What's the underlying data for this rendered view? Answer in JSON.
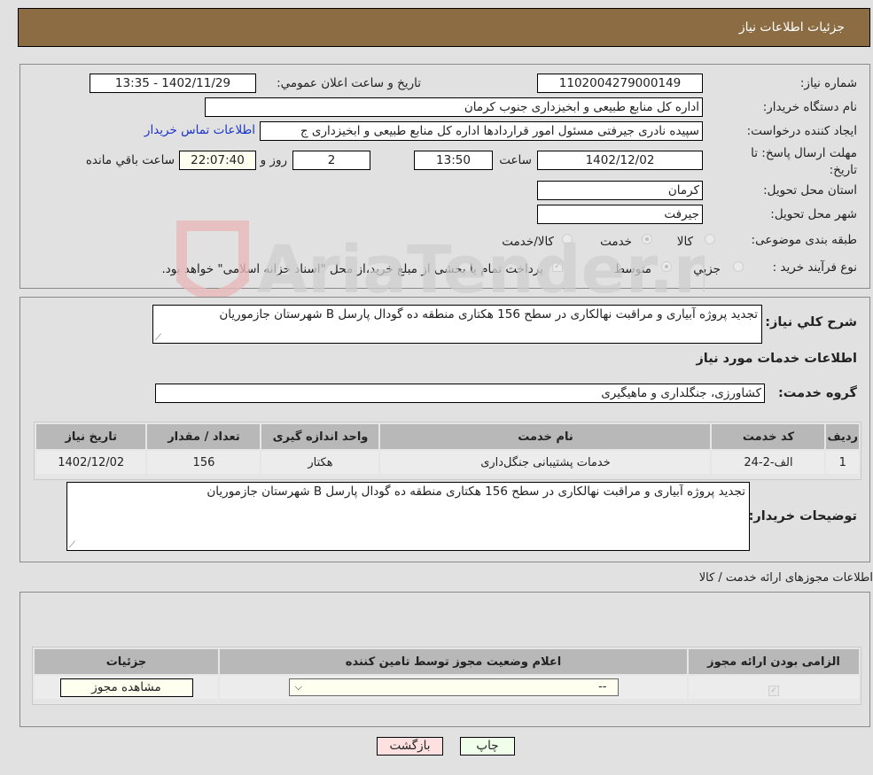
{
  "header": {
    "title": "جزئیات اطلاعات نیاز"
  },
  "details": {
    "need_number_label": "شماره نیاز:",
    "need_number": "1102004279000149",
    "announce_label": "تاریخ و ساعت اعلان عمومي:",
    "announce_value": "1402/11/29 - 13:35",
    "buyer_org_label": "نام دستگاه خريدار:",
    "buyer_org": "اداره کل منابع طبیعی و ابخیزداری جنوب کرمان",
    "creator_label": "ایجاد کننده درخواست:",
    "creator": "سپیده نادری جیرفتی مسئول امور قراردادها اداره کل منابع طبیعی و ابخیزداری ج",
    "contact_link": "اطلاعات تماس خریدار",
    "deadline_label": "مهلت ارسال پاسخ: تا تاریخ:",
    "deadline_date": "1402/12/02",
    "time_label": "ساعت",
    "deadline_time": "13:50",
    "days_value": "2",
    "days_label": "روز و",
    "remaining_time": "22:07:40",
    "remaining_label": "ساعت باقي مانده",
    "province_label": "استان محل تحویل:",
    "province": "کرمان",
    "city_label": "شهر محل تحویل:",
    "city": "جیرفت",
    "category_label": "طبقه بندی موضوعی:",
    "category_options": [
      {
        "label": "کالا",
        "checked": false
      },
      {
        "label": "خدمت",
        "checked": true
      },
      {
        "label": "کالا/خدمت",
        "checked": false
      }
    ],
    "process_label": "نوع فرآیند خرید :",
    "process_options": [
      {
        "label": "جزيي",
        "checked": false
      },
      {
        "label": "متوسط",
        "checked": true
      }
    ],
    "treasury_note": "پرداخت تمام یا بخشی از مبلغ خرید،از محل \"اسناد خزانه اسلامی\" خواهد بود.",
    "treasury_checked": true
  },
  "summary": {
    "label": "شرح کلي نياز:",
    "text": "تجدید پروژه آبیاری و مراقبت نهالکاری در سطح 156 هکتاری منطقه ده گودال پارسل B شهرستان جازموریان"
  },
  "services": {
    "section_title": "اطلاعات خدمات مورد نیاز",
    "group_label": "گروه خدمت:",
    "group_value": "کشاورزی، جنگلداری و ماهیگیری",
    "table": {
      "headers": [
        "ردیف",
        "کد خدمت",
        "نام خدمت",
        "واحد اندازه گیری",
        "تعداد / مقدار",
        "تاریخ نیاز"
      ],
      "rows": [
        [
          "1",
          "الف-2-24",
          "خدمات پشتیبانی جنگل‌داری",
          "هکتار",
          "156",
          "1402/12/02"
        ]
      ]
    },
    "buyer_notes_label": "توضیحات خریدار:",
    "buyer_notes": "تجدید پروژه آبیاری و مراقبت نهالکاری در سطح 156 هکتاری منطقه ده گودال پارسل B شهرستان جازموریان"
  },
  "licenses": {
    "section_title": "اطلاعات مجوزهای ارائه خدمت / کالا",
    "headers": [
      "الزامی بودن ارائه مجوز",
      "اعلام وضعیت مجوز توسط تامین کننده",
      "جزئیات"
    ],
    "row": {
      "required_checked": true,
      "status_value": "--",
      "details_button": "مشاهده مجوز"
    }
  },
  "actions": {
    "print": "چاپ",
    "back": "بازگشت"
  },
  "watermark": {
    "text": "AriaTender.neT"
  }
}
